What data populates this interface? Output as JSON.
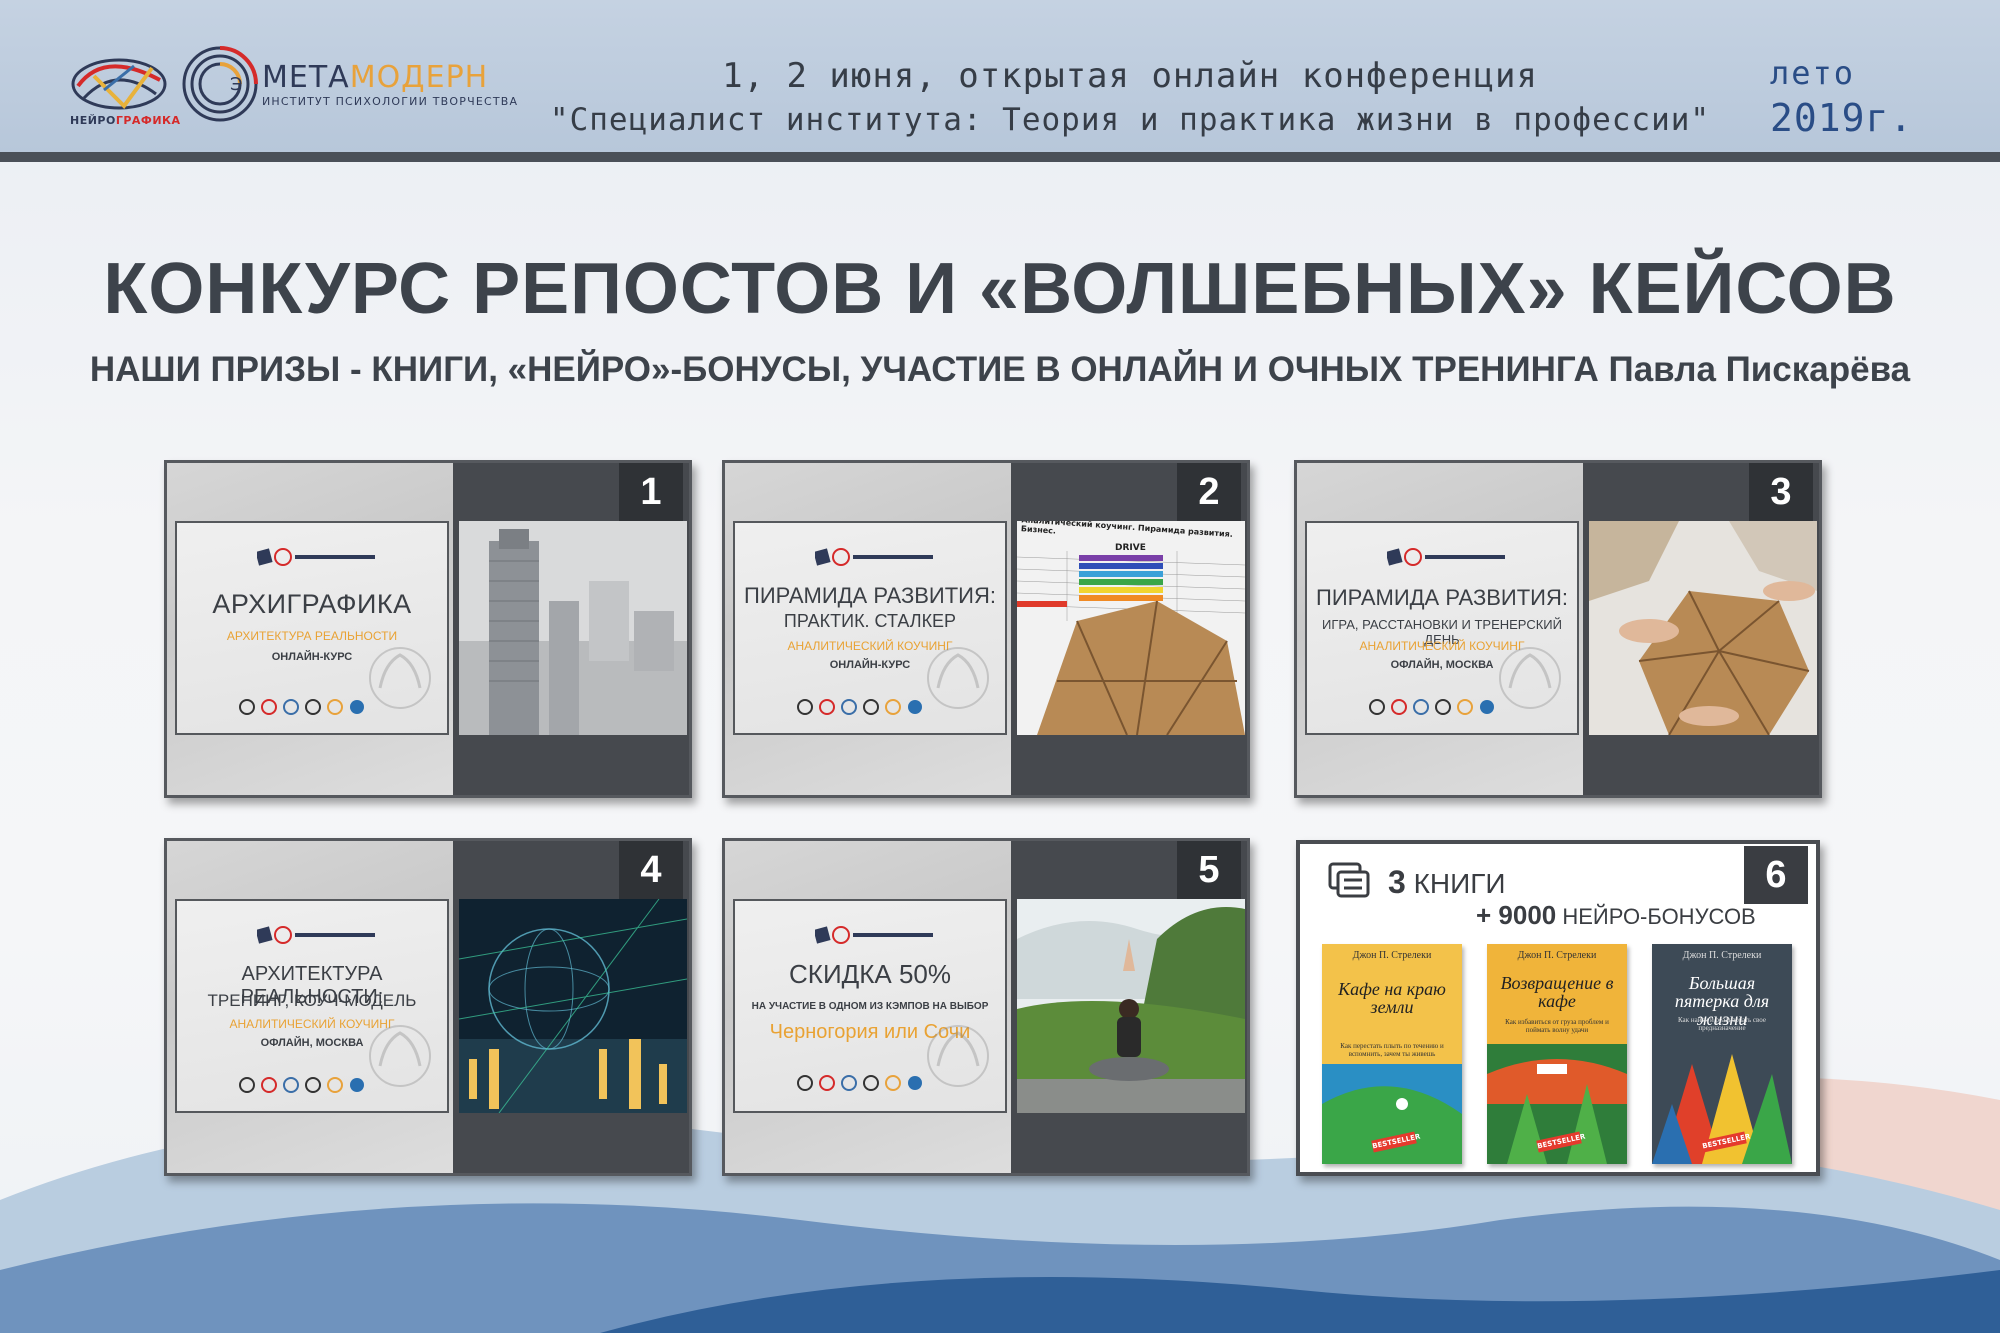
{
  "header": {
    "neuro_logo_label_a": "НЕЙРО",
    "neuro_logo_label_b": "ГРАФИКА",
    "meta_name_a": "МЕТА",
    "meta_name_b": "МОДЕРН",
    "meta_subtitle": "ИНСТИТУТ ПСИХОЛОГИИ ТВОРЧЕСТВА",
    "conference_line1": "1, 2 июня, открытая онлайн конференция",
    "conference_line2": "\"Специалист института: Теория и практика жизни в профессии\"",
    "season": "лето",
    "year": "2019г."
  },
  "title": "КОНКУРС РЕПОСТОВ И «ВОЛШЕБНЫХ» КЕЙСОВ",
  "subtitle": "НАШИ ПРИЗЫ - КНИГИ, «НЕЙРО»-БОНУСЫ, УЧАСТИЕ В ОНЛАЙН И ОЧНЫХ ТРЕНИНГА Павла Пискарёва",
  "cards": [
    {
      "number": "1",
      "title": "АРХИГРАФИКА",
      "accent": "АРХИТЕКТУРА РЕАЛЬНОСТИ",
      "format": "ОНЛАЙН-КУРС",
      "photo": "skyscraper-sketch"
    },
    {
      "number": "2",
      "title": "ПИРАМИДА РАЗВИТИЯ:",
      "title2": "ПРАКТИК. СТАЛКЕР",
      "accent": "АНАЛИТИЧЕСКИЙ КОУЧИНГ",
      "format": "ОНЛАЙН-КУРС",
      "photo": "pyramid-table",
      "photo_caption": "Аналитический коучинг. Пирамида развития. Бизнес.",
      "photo_label": "DRIVE"
    },
    {
      "number": "3",
      "title": "ПИРАМИДА РАЗВИТИЯ:",
      "title2": "ИГРА, РАССТАНОВКИ И ТРЕНЕРСКИЙ ДЕНЬ",
      "accent": "АНАЛИТИЧЕСКИЙ КОУЧИНГ",
      "format": "ОФЛАЙН, МОСКВА",
      "photo": "hands-pyramid"
    },
    {
      "number": "4",
      "title": "АРХИТЕКТУРА РЕАЛЬНОСТИ:",
      "title2": "ТРЕНИНГ, КОУЧ-МОДЕЛЬ",
      "accent": "АНАЛИТИЧЕСКИЙ КОУЧИНГ",
      "format": "ОФЛАЙН, МОСКВА",
      "photo": "network-globe"
    },
    {
      "number": "5",
      "title": "СКИДКА 50%",
      "title2": "НА УЧАСТИЕ В ОДНОМ ИЗ КЭМПОВ НА ВЫБОР",
      "accent": "Черногория или Сочи",
      "photo": "yoga-mountains"
    }
  ],
  "books_card": {
    "number": "6",
    "line1_num": "3",
    "line1_text": "КНИГИ",
    "line2_num": "+ 9000",
    "line2_text": "НЕЙРО-БОНУСОВ",
    "books": [
      {
        "author": "Джон П. Стрелеки",
        "title": "Кафе на краю земли",
        "subtitle": "Как перестать плыть по течению и вспомнить, зачем ты живешь",
        "badge": "BESTSELLER",
        "color": "#f3c24a"
      },
      {
        "author": "Джон П. Стрелеки",
        "title": "Возвращение в кафе",
        "subtitle": "Как избавиться от груза проблем и поймать волну удачи",
        "badge": "BESTSELLER",
        "color": "#f0b43a"
      },
      {
        "author": "Джон П. Стрелеки",
        "title": "Большая пятерка для жизни",
        "subtitle": "Как найти и реализовать свое предназначение",
        "badge": "BESTSELLER",
        "color": "#3d4a56"
      }
    ]
  },
  "colors": {
    "header_bg": "#bccadc",
    "header_border": "#4a5058",
    "title": "#3d434b",
    "accent_orange": "#e9a233",
    "year_blue": "#2a4d86"
  }
}
